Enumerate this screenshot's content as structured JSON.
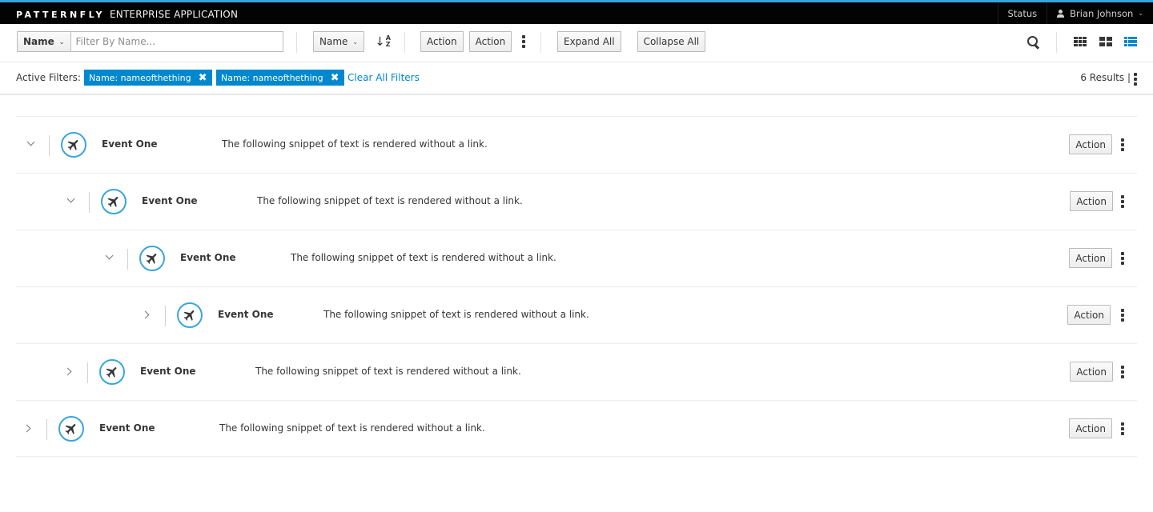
{
  "masthead": {
    "brand": "PATTERNFLY",
    "product": "ENTERPRISE APPLICATION",
    "status_label": "Status",
    "user_name": "Brian Johnson",
    "accent_color": "#39a5dc"
  },
  "toolbar": {
    "filter_type": "Name",
    "filter_placeholder": "Filter By Name...",
    "sort_field": "Name",
    "action_1": "Action",
    "action_2": "Action",
    "expand_all": "Expand All",
    "collapse_all": "Collapse All"
  },
  "filters": {
    "label": "Active Filters:",
    "chips": [
      {
        "label": "Name: nameofthething"
      },
      {
        "label": "Name: nameofthething"
      }
    ],
    "clear_all": "Clear All Filters",
    "results": "6 Results |",
    "chip_color": "#0088ce"
  },
  "list": {
    "rows": [
      {
        "title": "Event One",
        "description": "The following snippet of text is rendered without a link.",
        "action": "Action",
        "expanded": true,
        "level": 0
      },
      {
        "title": "Event One",
        "description": "The following snippet of text is rendered without a link.",
        "action": "Action",
        "expanded": true,
        "level": 1
      },
      {
        "title": "Event One",
        "description": "The following snippet of text is rendered without a link.",
        "action": "Action",
        "expanded": true,
        "level": 2
      },
      {
        "title": "Event One",
        "description": "The following snippet of text is rendered without a link.",
        "action": "Action",
        "expanded": false,
        "level": 3
      },
      {
        "title": "Event One",
        "description": "The following snippet of text is rendered without a link.",
        "action": "Action",
        "expanded": false,
        "level": 1
      },
      {
        "title": "Event One",
        "description": "The following snippet of text is rendered without a link.",
        "action": "Action",
        "expanded": false,
        "level": 0
      }
    ],
    "icon": "plane-icon"
  }
}
